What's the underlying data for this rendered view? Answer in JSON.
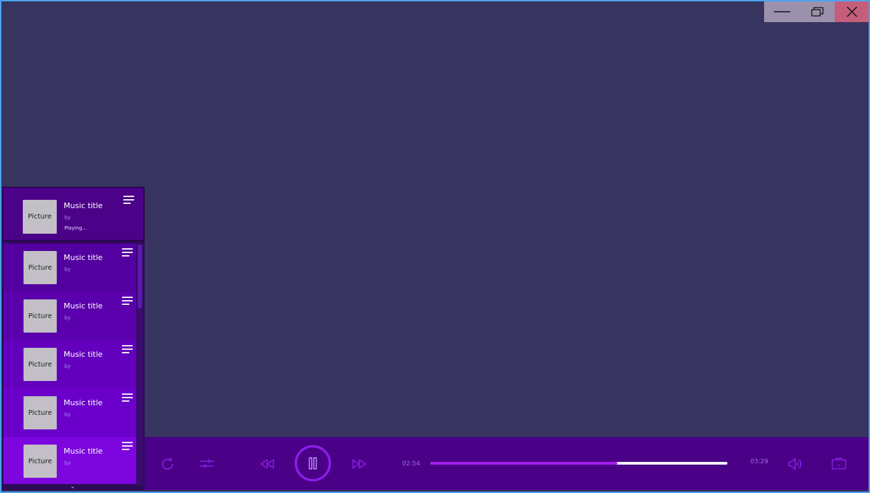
{
  "window_controls": {
    "minimize": "minimize",
    "maximize": "restore",
    "close": "close"
  },
  "playlist": {
    "now_playing": {
      "picture": "Picture",
      "title": "Music title",
      "artist": "by",
      "status": "Playing..."
    },
    "items": [
      {
        "picture": "Picture",
        "title": "Music title",
        "artist": "by"
      },
      {
        "picture": "Picture",
        "title": "Music title",
        "artist": "by"
      },
      {
        "picture": "Picture",
        "title": "Music title",
        "artist": "by"
      },
      {
        "picture": "Picture",
        "title": "Music title",
        "artist": "by"
      },
      {
        "picture": "Picture",
        "title": "Music title",
        "artist": "by"
      }
    ],
    "item_colors": [
      "#5300a0",
      "#5a00ac",
      "#6300bd",
      "#6b00cb",
      "#7d06df"
    ],
    "scroll_arrow": "⌄"
  },
  "player": {
    "elapsed": "02:54",
    "total": "03:29",
    "progress_fraction": 0.63,
    "icons": [
      "repeat-icon",
      "equalizer-icon",
      "rewind-icon",
      "pause-icon",
      "fast-forward-icon",
      "volume-icon",
      "playlist-icon"
    ]
  },
  "colors": {
    "background": "#37355f",
    "control_bar": "#4b0187",
    "accent": "#a321ef",
    "icon": "#8a1fe8"
  }
}
